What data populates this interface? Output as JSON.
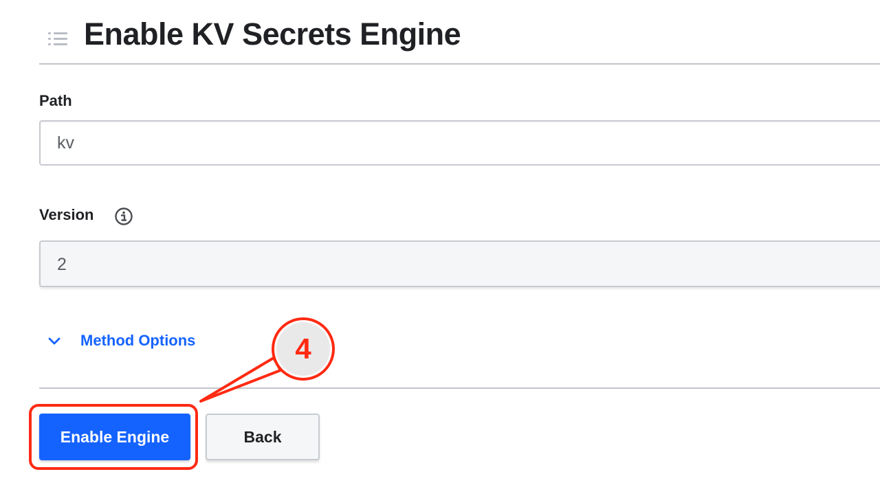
{
  "header": {
    "title": "Enable KV Secrets Engine",
    "menu_icon": "list-icon"
  },
  "form": {
    "path": {
      "label": "Path",
      "value": "kv"
    },
    "version": {
      "label": "Version",
      "info_icon": "info-icon",
      "selected": "2"
    },
    "method_options": {
      "label": "Method Options",
      "icon": "chevron-down-icon"
    }
  },
  "actions": {
    "enable_label": "Enable Engine",
    "back_label": "Back"
  },
  "annotation": {
    "step_number": "4",
    "color": "#ff2a12"
  },
  "colors": {
    "primary": "#1563ff",
    "text": "#1f2124",
    "border": "#c7cad0"
  }
}
